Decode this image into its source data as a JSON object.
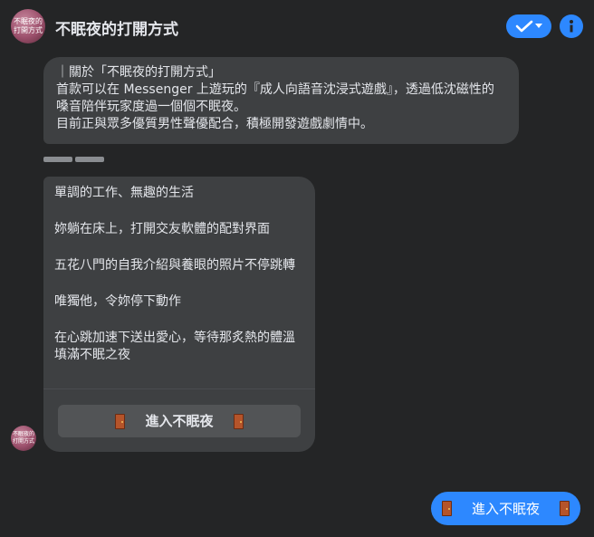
{
  "header": {
    "avatar_text_line1": "不眠夜的",
    "avatar_text_line2": "打開方式",
    "title": "不眠夜的打開方式",
    "check_icon": "check-icon",
    "info_icon": "info-icon"
  },
  "messages": {
    "intro": {
      "line1": "｜關於「不眠夜的打開方式」",
      "line2": "首款可以在 Messenger 上遊玩的『成人向語音沈浸式遊戲』，透過低沈磁性的嗓音陪伴玩家度過一個個不眠夜。",
      "line3": "目前正與眾多優質男性聲優配合，積極開發遊戲劇情中。"
    },
    "story": {
      "paragraphs": [
        "單調的工作、無趣的生活",
        "妳躺在床上，打開交友軟體的配對界面",
        "五花八門的自我介紹與養眼的照片不停跳轉",
        "唯獨他，令妳停下動作",
        "在心跳加速下送出愛心，等待那炙熱的體溫填滿不眠之夜"
      ],
      "button_label": "進入不眠夜",
      "button_icon": "door-icon"
    },
    "sent": {
      "label": "進入不眠夜",
      "icon": "door-icon"
    }
  },
  "colors": {
    "background": "#242526",
    "bubble": "#3e4042",
    "accent": "#2d88ff",
    "text": "#e4e6eb"
  }
}
